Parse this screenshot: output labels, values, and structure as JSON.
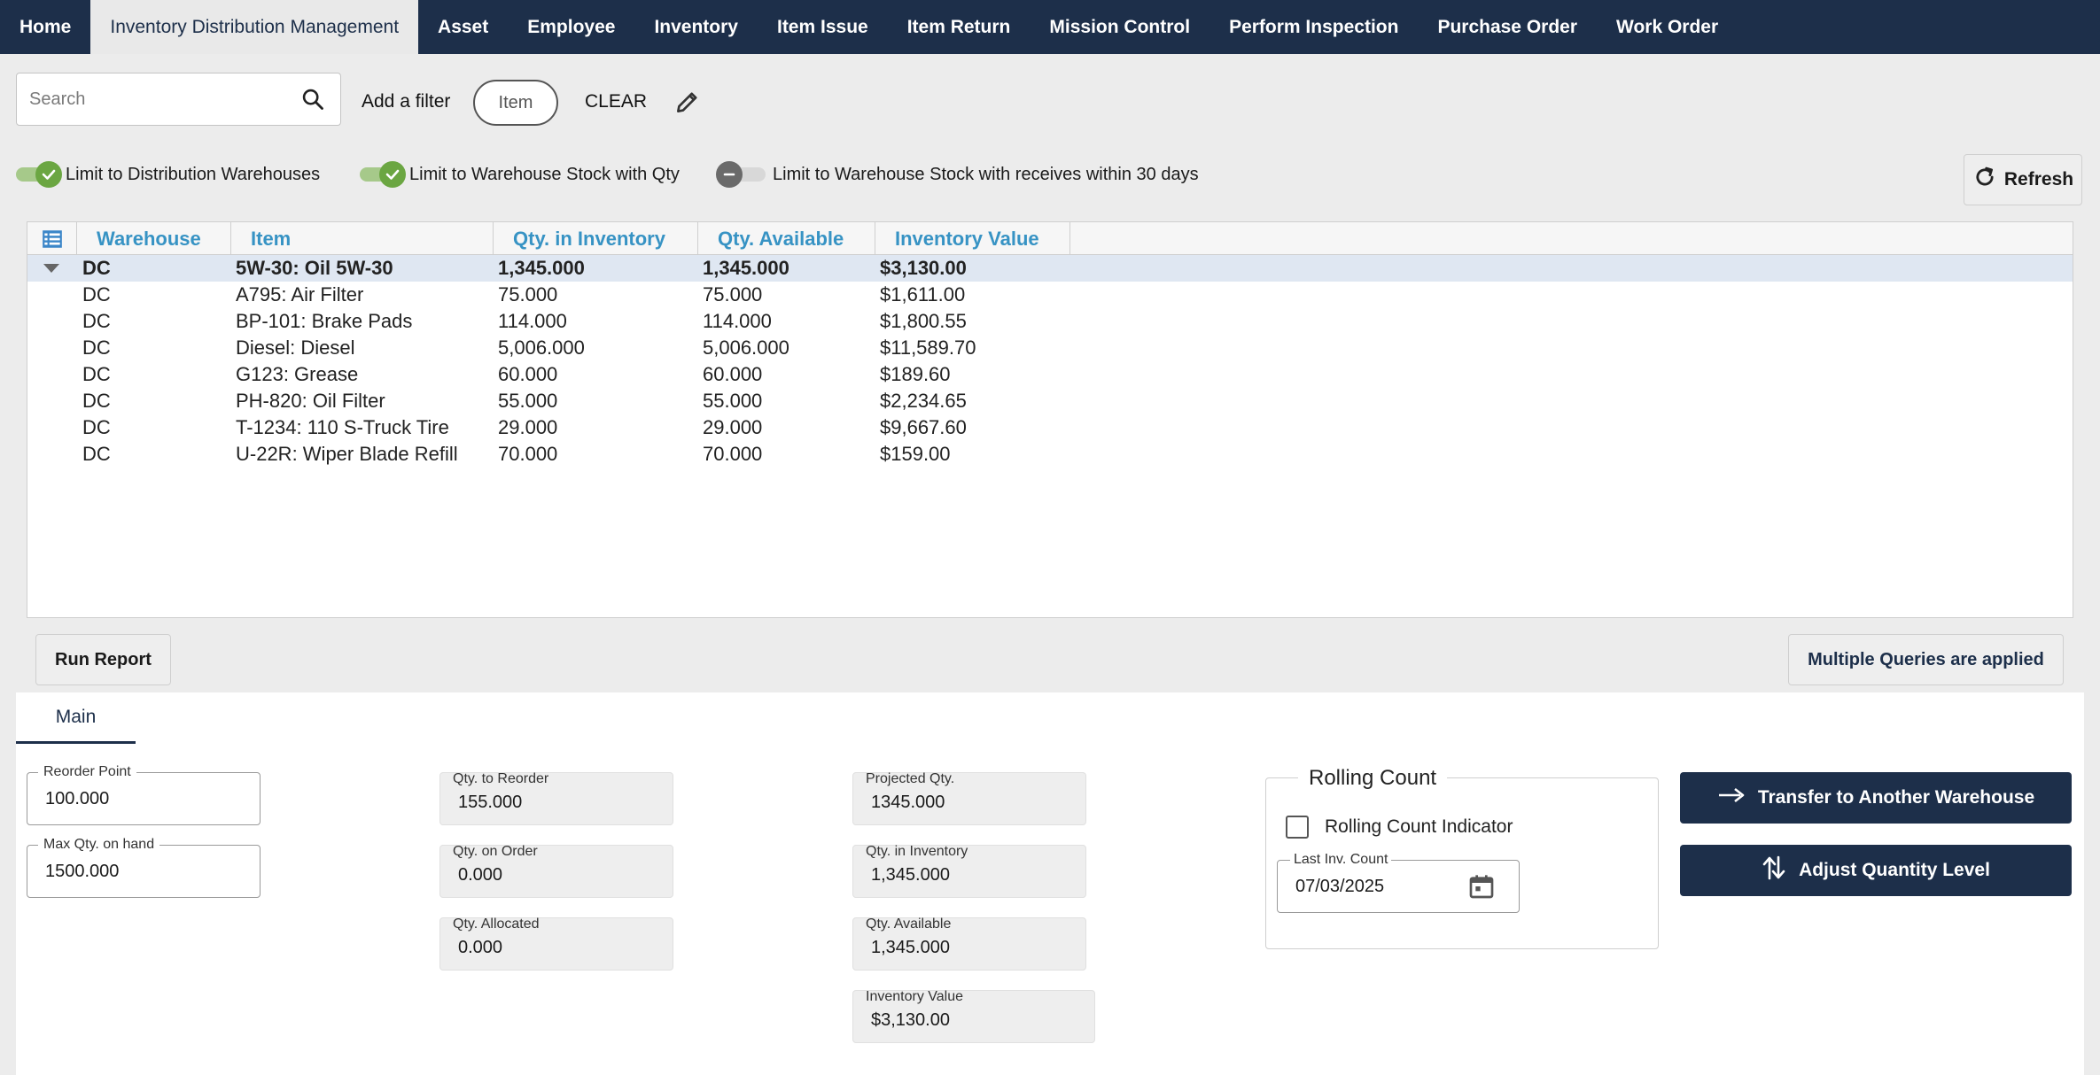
{
  "nav": {
    "tabs": [
      {
        "label": "Home"
      },
      {
        "label": "Inventory Distribution Management"
      },
      {
        "label": "Asset"
      },
      {
        "label": "Employee"
      },
      {
        "label": "Inventory"
      },
      {
        "label": "Item Issue"
      },
      {
        "label": "Item Return"
      },
      {
        "label": "Mission Control"
      },
      {
        "label": "Perform Inspection"
      },
      {
        "label": "Purchase Order"
      },
      {
        "label": "Work Order"
      }
    ],
    "active_index": 1
  },
  "filters": {
    "search_placeholder": "Search",
    "add_filter_label": "Add a filter",
    "chip_label": "Item",
    "clear_label": "CLEAR"
  },
  "toggles": [
    {
      "label": "Limit to Distribution Warehouses",
      "on": true
    },
    {
      "label": "Limit to Warehouse Stock with Qty",
      "on": true
    },
    {
      "label": "Limit to Warehouse Stock with receives within 30 days",
      "on": false
    }
  ],
  "refresh_label": "Refresh",
  "grid": {
    "columns": [
      "Warehouse",
      "Item",
      "Qty. in Inventory",
      "Qty. Available",
      "Inventory Value"
    ],
    "rows": [
      [
        "DC",
        "5W-30: Oil 5W-30",
        "1,345.000",
        "1,345.000",
        "$3,130.00"
      ],
      [
        "DC",
        "A795: Air Filter",
        "75.000",
        "75.000",
        "$1,611.00"
      ],
      [
        "DC",
        "BP-101: Brake Pads",
        "114.000",
        "114.000",
        "$1,800.55"
      ],
      [
        "DC",
        "Diesel: Diesel",
        "5,006.000",
        "5,006.000",
        "$11,589.70"
      ],
      [
        "DC",
        "G123: Grease",
        "60.000",
        "60.000",
        "$189.60"
      ],
      [
        "DC",
        "PH-820: Oil Filter",
        "55.000",
        "55.000",
        "$2,234.65"
      ],
      [
        "DC",
        "T-1234: 110 S-Truck Tire",
        "29.000",
        "29.000",
        "$9,667.60"
      ],
      [
        "DC",
        "U-22R: Wiper Blade Refill",
        "70.000",
        "70.000",
        "$159.00"
      ]
    ],
    "selected_index": 0
  },
  "actions": {
    "run_report": "Run Report",
    "multiple_queries": "Multiple Queries are applied"
  },
  "detail": {
    "tab": "Main",
    "reorder_point": {
      "label": "Reorder Point",
      "value": "100.000"
    },
    "max_qty": {
      "label": "Max Qty. on hand",
      "value": "1500.000"
    },
    "qty_to_reorder": {
      "label": "Qty. to Reorder",
      "value": "155.000"
    },
    "qty_on_order": {
      "label": "Qty. on Order",
      "value": "0.000"
    },
    "qty_allocated": {
      "label": "Qty. Allocated",
      "value": "0.000"
    },
    "projected_qty": {
      "label": "Projected Qty.",
      "value": "1345.000"
    },
    "qty_in_inventory": {
      "label": "Qty. in Inventory",
      "value": "1,345.000"
    },
    "qty_available": {
      "label": "Qty. Available",
      "value": "1,345.000"
    },
    "inventory_value": {
      "label": "Inventory Value",
      "value": "$3,130.00"
    },
    "rolling_count": {
      "title": "Rolling Count",
      "indicator_label": "Rolling Count Indicator",
      "indicator_checked": false,
      "last_count_label": "Last Inv. Count",
      "last_count_value": "07/03/2025"
    },
    "transfer_label": "Transfer to Another Warehouse",
    "adjust_label": "Adjust Quantity Level"
  },
  "colors": {
    "nav_bg": "#1d2f4a",
    "header_text": "#3793c4",
    "toggle_on": "#6ba642",
    "selected_row": "#dfe7f2"
  }
}
